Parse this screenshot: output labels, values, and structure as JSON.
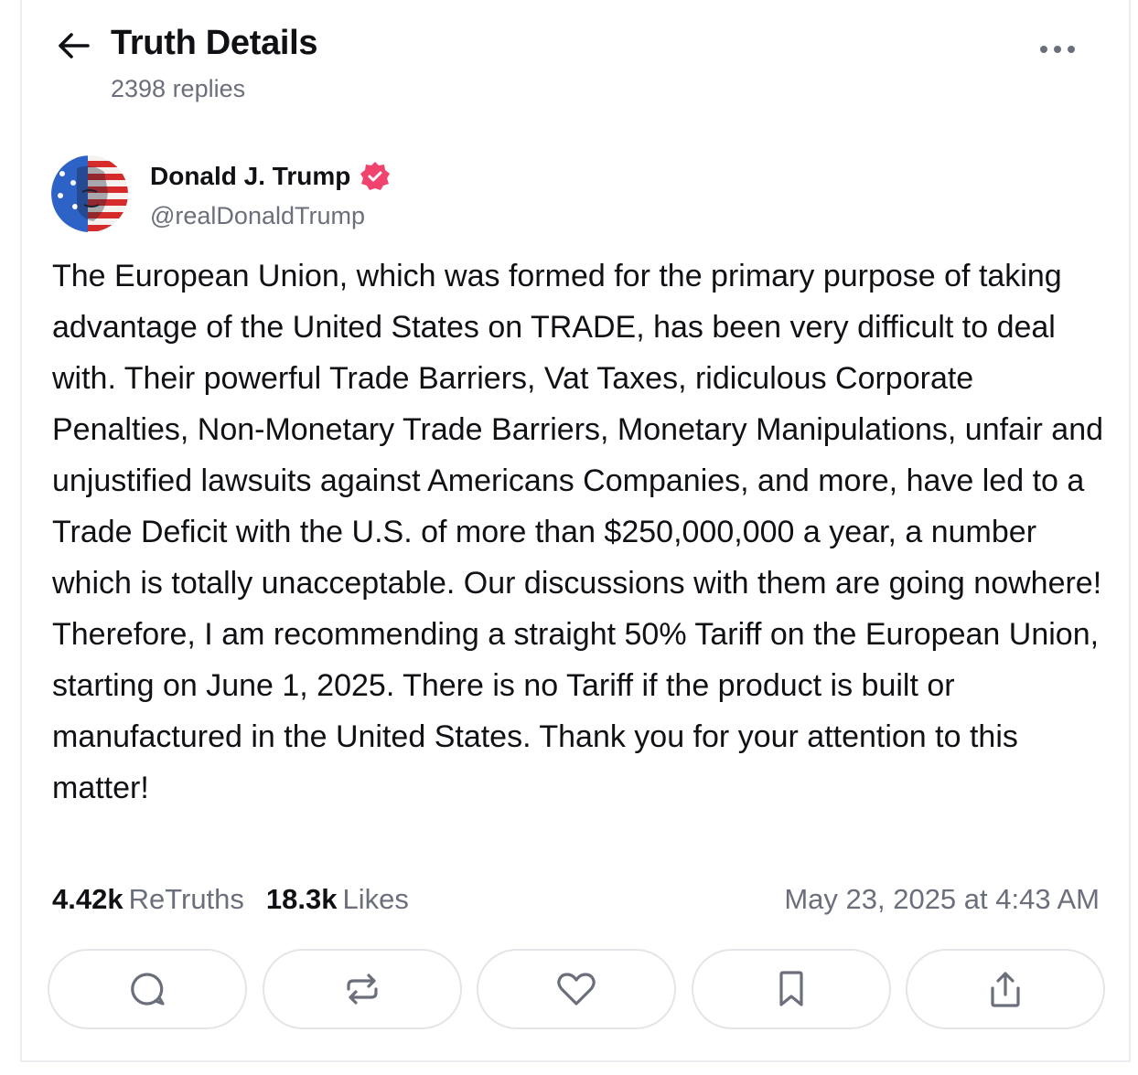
{
  "header": {
    "title": "Truth Details",
    "replies": "2398 replies",
    "back_icon": "arrow-left-icon",
    "more_icon": "more-dots-icon"
  },
  "author": {
    "name": "Donald J. Trump",
    "handle": "@realDonaldTrump",
    "verified_icon": "verified-badge-icon",
    "verified_color": "#f0446e"
  },
  "post": {
    "text": "The European Union, which was formed for the primary purpose of taking advantage of the United States on TRADE, has been very difficult to deal with. Their powerful Trade Barriers, Vat Taxes, ridiculous Corporate Penalties, Non-Monetary Trade Barriers, Monetary Manipulations, unfair and unjustified lawsuits against Americans Companies, and more, have led to a Trade Deficit with the U.S. of more than $250,000,000 a year, a number which is totally unacceptable. Our discussions with them are going nowhere! Therefore, I am recommending a straight 50% Tariff on the European Union, starting on June 1, 2025. There is no Tariff if the product is built or manufactured in the United States. Thank you for your attention to this matter!"
  },
  "stats": {
    "retruths_count": "4.42k",
    "retruths_label": "ReTruths",
    "likes_count": "18.3k",
    "likes_label": "Likes",
    "timestamp": "May 23, 2025 at 4:43 AM"
  },
  "actions": [
    {
      "icon": "reply-icon"
    },
    {
      "icon": "retruth-icon"
    },
    {
      "icon": "like-heart-icon"
    },
    {
      "icon": "bookmark-icon"
    },
    {
      "icon": "share-icon"
    }
  ],
  "colors": {
    "text": "#0f1115",
    "muted": "#6b6f7b",
    "border": "#e4e4e9"
  }
}
